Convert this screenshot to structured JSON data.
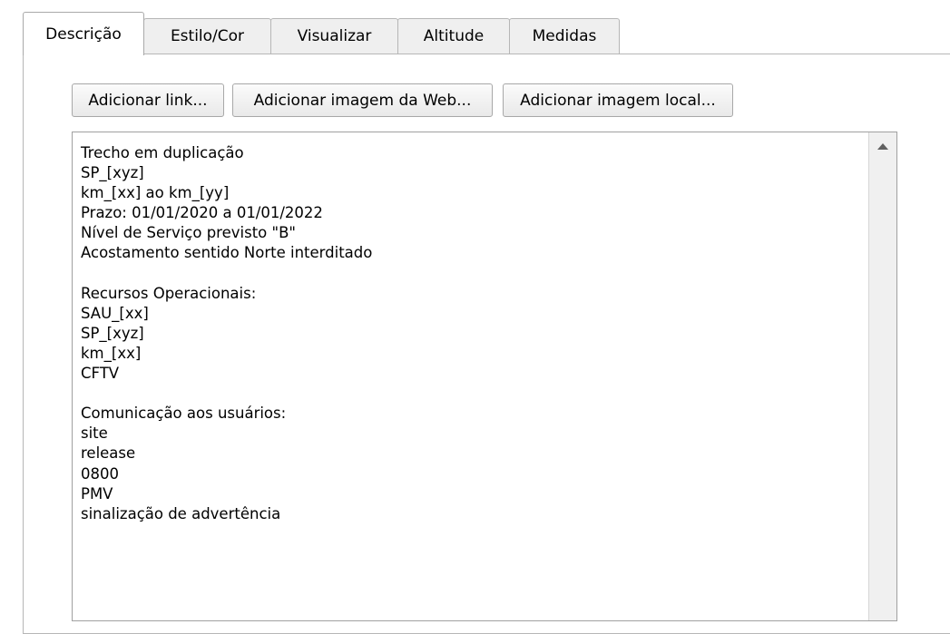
{
  "tabs": [
    {
      "label": "Descrição",
      "active": true
    },
    {
      "label": "Estilo/Cor",
      "active": false
    },
    {
      "label": "Visualizar",
      "active": false
    },
    {
      "label": "Altitude",
      "active": false
    },
    {
      "label": "Medidas",
      "active": false
    }
  ],
  "toolbar": {
    "add_link": "Adicionar link...",
    "add_web_image": "Adicionar imagem da Web...",
    "add_local_image": "Adicionar imagem local..."
  },
  "description": {
    "lines": [
      "Trecho em duplicação",
      "SP_[xyz]",
      "km_[xx] ao km_[yy]",
      "Prazo: 01/01/2020 a 01/01/2022",
      "Nível de Serviço previsto \"B\"",
      "Acostamento sentido Norte interditado",
      "",
      "Recursos Operacionais:",
      "SAU_[xx]",
      "SP_[xyz]",
      "km_[xx]",
      "CFTV",
      "",
      "Comunicação aos usuários:",
      "site",
      "release",
      "0800",
      "PMV",
      "sinalização de advertência"
    ]
  },
  "icons": {
    "scroll_up": "triangle-up-icon"
  }
}
